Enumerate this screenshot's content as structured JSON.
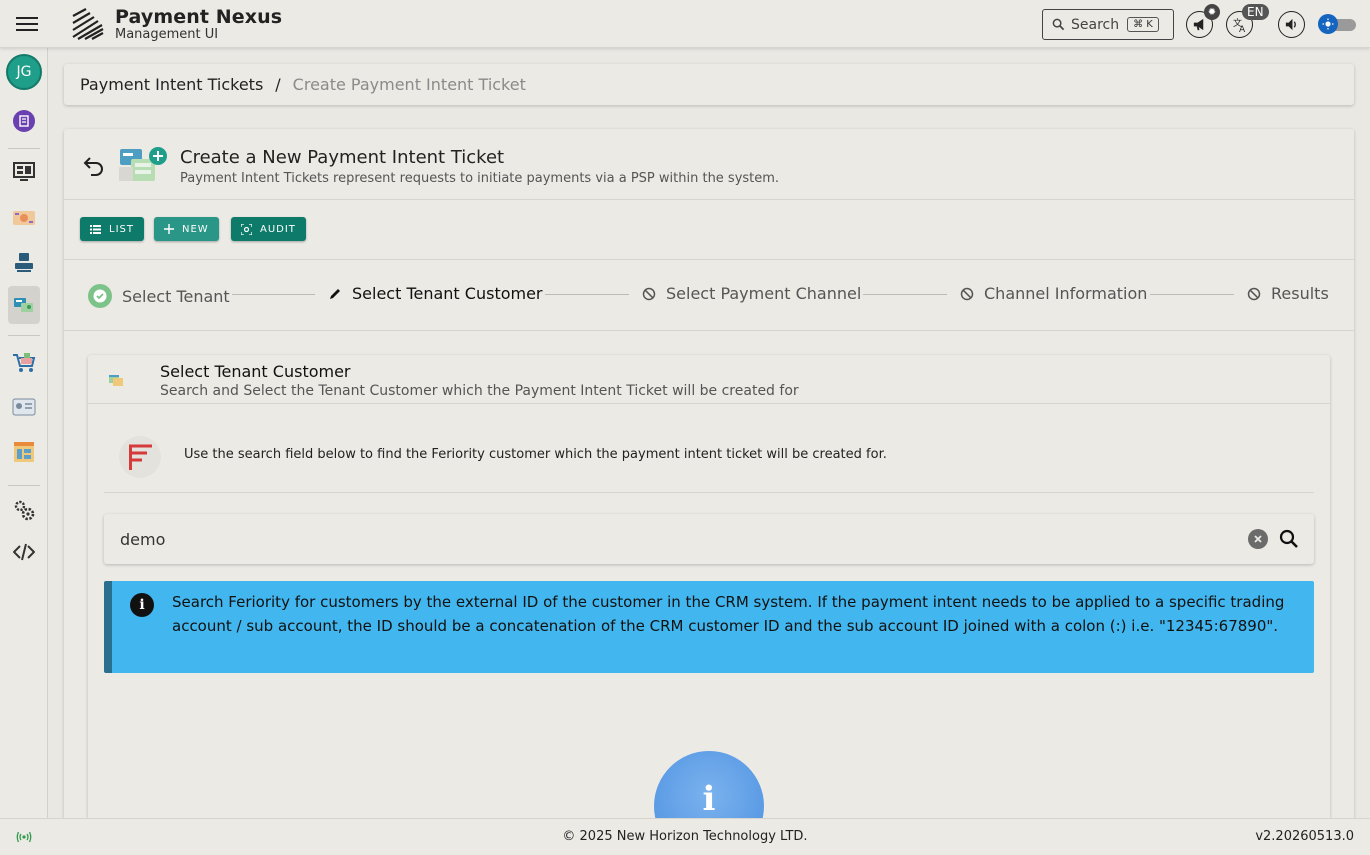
{
  "app": {
    "title": "Payment Nexus",
    "subtitle": "Management UI"
  },
  "topbar": {
    "search_label": "Search",
    "search_shortcut": "⌘ K",
    "language": "EN"
  },
  "user": {
    "initials": "JG"
  },
  "breadcrumb": {
    "parent": "Payment Intent Tickets",
    "separator": "/",
    "current": "Create Payment Intent Ticket"
  },
  "page": {
    "title": "Create a New Payment Intent Ticket",
    "subtitle": "Payment Intent Tickets represent requests to initiate payments via a PSP within the system."
  },
  "actions": {
    "list": "LIST",
    "new": "NEW",
    "audit": "AUDIT"
  },
  "stepper": {
    "steps": [
      {
        "label": "Select Tenant",
        "state": "complete"
      },
      {
        "label": "Select Tenant Customer",
        "state": "active"
      },
      {
        "label": "Select Payment Channel",
        "state": "disabled"
      },
      {
        "label": "Channel Information",
        "state": "disabled"
      },
      {
        "label": "Results",
        "state": "disabled"
      }
    ]
  },
  "customer_step": {
    "title": "Select Tenant Customer",
    "subtitle": "Search and Select the Tenant Customer which the Payment Intent Ticket will be created for",
    "instruction": "Use the search field below to find the Feriority customer which the payment intent ticket will be created for.",
    "search_value": "demo",
    "info_text": "Search Feriority for customers by the external ID of the customer in the CRM system. If the payment intent needs to be applied to a specific trading account / sub account, the ID should be a concatenation of the CRM customer ID and the sub account ID joined with a colon (:) i.e. \"12345:67890\".",
    "big_info_glyph": "i"
  },
  "footer": {
    "copyright": "© 2025 New Horizon Technology LTD.",
    "version": "v2.20260513.0"
  },
  "colors": {
    "primary": "#0d7a6a",
    "info": "#42b7ef",
    "avatar": "#1f9e8a",
    "success": "#7cc38a"
  }
}
